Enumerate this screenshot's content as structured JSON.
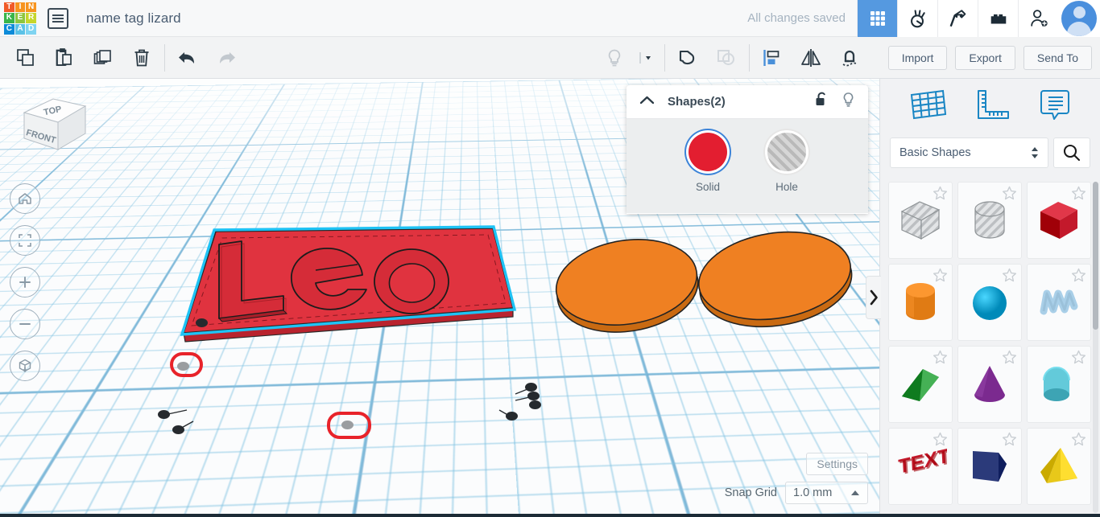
{
  "app": {
    "logo_letters": [
      {
        "ch": "T",
        "color": "#f05a28"
      },
      {
        "ch": "I",
        "color": "#f7941e"
      },
      {
        "ch": "N",
        "color": "#f7941e"
      },
      {
        "ch": "K",
        "color": "#39b54a"
      },
      {
        "ch": "E",
        "color": "#8dc63f"
      },
      {
        "ch": "R",
        "color": "#c6d62c"
      },
      {
        "ch": "C",
        "color": "#0d8bd9"
      },
      {
        "ch": "A",
        "color": "#5bc2e7"
      },
      {
        "ch": "D",
        "color": "#7fd4f1"
      }
    ],
    "doc_title": "name tag lizard",
    "save_status": "All changes saved",
    "menu_icon": "list-menu-icon"
  },
  "header_nav": [
    {
      "name": "designs-grid-icon",
      "label": "Designs",
      "active": true
    },
    {
      "name": "circuits-icon",
      "label": "Circuits",
      "active": false
    },
    {
      "name": "codeblocks-pickaxe-icon",
      "label": "Codeblocks",
      "active": false
    },
    {
      "name": "blocks-brick-icon",
      "label": "Blocks",
      "active": false
    },
    {
      "name": "add-person-icon",
      "label": "Invite",
      "active": false
    }
  ],
  "toolbar": {
    "left_tools": [
      {
        "name": "copy-icon",
        "label": "Copy"
      },
      {
        "name": "paste-icon",
        "label": "Paste"
      },
      {
        "name": "duplicate-icon",
        "label": "Duplicate"
      },
      {
        "name": "delete-trash-icon",
        "label": "Delete"
      },
      {
        "name": "undo-arrow-icon",
        "label": "Undo"
      },
      {
        "name": "redo-arrow-icon",
        "label": "Redo"
      }
    ],
    "right_tools": [
      {
        "name": "lightbulb-icon",
        "label": "Light"
      },
      {
        "name": "chevron-down-icon",
        "label": "Light options"
      },
      {
        "name": "group-icon",
        "label": "Group"
      },
      {
        "name": "ungroup-icon",
        "label": "Ungroup"
      },
      {
        "name": "align-icon",
        "label": "Align"
      },
      {
        "name": "mirror-icon",
        "label": "Mirror"
      },
      {
        "name": "magnet-snap-icon",
        "label": "Snap"
      }
    ],
    "import_label": "Import",
    "export_label": "Export",
    "sendto_label": "Send To"
  },
  "viewport": {
    "viewcube": {
      "top_face": "TOP",
      "front_face": "FRONT"
    },
    "nav_buttons": [
      {
        "name": "home-view-icon",
        "label": "Home view"
      },
      {
        "name": "fit-to-view-icon",
        "label": "Fit all in view"
      },
      {
        "name": "zoom-in-icon",
        "label": "Zoom in"
      },
      {
        "name": "zoom-out-icon",
        "label": "Zoom out"
      },
      {
        "name": "ortho-perspective-icon",
        "label": "Switch to orthographic"
      }
    ],
    "objects": [
      {
        "name": "name-tag-plate",
        "text": "Leo",
        "color": "#e0333f",
        "selected": true
      },
      {
        "name": "orange-disc-left",
        "color": "#ef8022",
        "selected": false
      },
      {
        "name": "orange-disc-right",
        "color": "#ef8022",
        "selected": false
      }
    ],
    "settings_label": "Settings",
    "snap_grid_label": "Snap Grid",
    "snap_grid_value": "1.0 mm"
  },
  "shapes_popup": {
    "title": "Shapes(2)",
    "collapse_icon": "chevron-up-icon",
    "lock_icon": "unlock-icon",
    "light_icon": "lightbulb-icon",
    "solid_label": "Solid",
    "hole_label": "Hole",
    "solid_color": "#e31e30",
    "selected": "Solid"
  },
  "right_panel": {
    "tabs": [
      {
        "name": "workplane-icon",
        "label": "Workplane"
      },
      {
        "name": "ruler-icon",
        "label": "Ruler"
      },
      {
        "name": "notes-callout-icon",
        "label": "Notes"
      }
    ],
    "category_value": "Basic Shapes",
    "search_icon": "search-icon",
    "shapes": [
      {
        "name": "box-hole",
        "label": "Box Hole",
        "color": "#c9cbcd",
        "kind": "hole-box"
      },
      {
        "name": "cylinder-hole",
        "label": "Cylinder Hole",
        "color": "#c9cbcd",
        "kind": "hole-cylinder"
      },
      {
        "name": "box-red",
        "label": "Box",
        "color": "#c3192b",
        "kind": "box"
      },
      {
        "name": "cylinder-orange",
        "label": "Cylinder",
        "color": "#e07b14",
        "kind": "cylinder"
      },
      {
        "name": "sphere-blue",
        "label": "Sphere",
        "color": "#13a0cf",
        "kind": "sphere"
      },
      {
        "name": "scribble",
        "label": "Scribble",
        "color": "#a9cfe8",
        "kind": "scribble"
      },
      {
        "name": "roof-green",
        "label": "Roof",
        "color": "#2f9b3f",
        "kind": "wedge"
      },
      {
        "name": "cone-purple",
        "label": "Cone",
        "color": "#7b2a8f",
        "kind": "cone"
      },
      {
        "name": "halfsphere-teal",
        "label": "Half Sphere",
        "color": "#4fb6c6",
        "kind": "dome"
      },
      {
        "name": "text-red",
        "label": "Text",
        "color": "#c3192b",
        "kind": "text"
      },
      {
        "name": "polygon-navy",
        "label": "Polygon",
        "color": "#2b3a7a",
        "kind": "polygon"
      },
      {
        "name": "pyramid-yellow",
        "label": "Pyramid",
        "color": "#e8c81a",
        "kind": "pyramid"
      }
    ]
  }
}
